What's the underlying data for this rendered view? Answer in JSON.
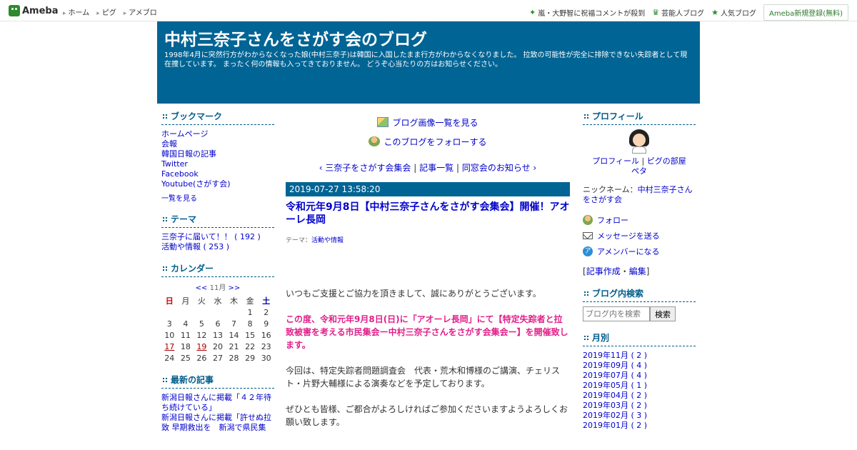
{
  "topbar": {
    "logo_text": "Ameba",
    "nav": [
      "ホーム",
      "ピグ",
      "アメブロ"
    ],
    "right_links": [
      {
        "label": "嵐・大野智に祝福コメントが殺到",
        "icon": "sparkle-icon"
      },
      {
        "label": "芸能人ブログ",
        "icon": "crown-icon"
      },
      {
        "label": "人気ブログ",
        "icon": "star-icon"
      }
    ],
    "signup_label": "Ameba新規登録(無料)"
  },
  "header": {
    "title": "中村三奈子さんをさがす会のブログ",
    "description": "1998年4月に突然行方がわからなくなった娘(中村三奈子)は韓国に入国したまま行方がわからなくなりました。 拉致の可能性が完全に排除できない失踪者として現在捜しています。 まったく何の情報も入ってきておりません。 どうぞ心当たりの方はお知らせください。"
  },
  "left": {
    "bookmarks": {
      "heading": "ブックマーク",
      "items": [
        "ホームページ",
        "会報",
        "韓国日報の記事",
        "Twitter",
        "Facebook",
        "Youtube(さがす会)"
      ],
      "more": "一覧を見る"
    },
    "themes": {
      "heading": "テーマ",
      "items": [
        "三奈子に届いて！！ ( 192 )",
        "活動や情報 ( 253 )"
      ]
    },
    "calendar": {
      "heading": "カレンダー",
      "prev": "<<",
      "month": "11月",
      "next": ">>",
      "weekdays": [
        "日",
        "月",
        "火",
        "水",
        "木",
        "金",
        "土"
      ],
      "weeks": [
        [
          "",
          "",
          "",
          "",
          "",
          "1",
          "2"
        ],
        [
          "3",
          "4",
          "5",
          "6",
          "7",
          "8",
          "9"
        ],
        [
          "10",
          "11",
          "12",
          "13",
          "14",
          "15",
          "16"
        ],
        [
          "17",
          "18",
          "19",
          "20",
          "21",
          "22",
          "23"
        ],
        [
          "24",
          "25",
          "26",
          "27",
          "28",
          "29",
          "30"
        ]
      ],
      "linked_days": [
        "17",
        "19"
      ]
    },
    "recent": {
      "heading": "最新の記事",
      "items": [
        "新潟日報さんに掲載「４２年待ち続けている」",
        "新潟日報さんに掲載「許せぬ拉致 早期救出を　新潟で県民集"
      ]
    }
  },
  "center": {
    "image_list_link": "ブログ画像一覧を見る",
    "follow_link": "このブログをフォローする",
    "pager": {
      "prev": "三奈子をさがす会集会",
      "sep1": "|",
      "list": "記事一覧",
      "sep2": "|",
      "next": "同窓会のお知らせ"
    },
    "entry": {
      "date": "2019-07-27 13:58:20",
      "title": "令和元年9月8日【中村三奈子さんをさがす会集会】開催！アオーレ長岡",
      "theme_label": "テーマ：",
      "theme": "活動や情報",
      "p1": "いつもご支援とご協力を頂きまして、誠にありがとうございます。",
      "p2": "この度、令和元年9月8日(日)に「アオーレ長岡」にて【特定失踪者と拉致被害を考える市民集会ー中村三奈子さんをさがす会集会ー】を開催致します。",
      "p3": "今回は、特定失踪者問題調査会　代表・荒木和博様のご講演、チェリスト・片野大輔様による演奏などを予定しております。",
      "p4": "ぜひとも皆様、ご都合がよろしければご参加くださいますようよろしくお願い致します。"
    }
  },
  "right": {
    "profile": {
      "heading": "プロフィール",
      "link_profile": "プロフィール",
      "sep": "|",
      "link_pigu": "ピグの部屋",
      "link_peta": "ペタ",
      "nickname_label": "ニックネーム：",
      "nickname": "中村三奈子さんをさがす会"
    },
    "actions": {
      "follow": "フォロー",
      "message": "メッセージを送る",
      "amember": "アメンバーになる",
      "amember_glyph": "ア"
    },
    "edit": {
      "open": "[",
      "create": "記事作成",
      "dot": "・",
      "edit": "編集",
      "close": "]"
    },
    "search": {
      "heading": "ブログ内検索",
      "placeholder": "ブログ内を検索",
      "button": "検索"
    },
    "monthly": {
      "heading": "月別",
      "items": [
        "2019年11月 ( 2 )",
        "2019年09月 ( 4 )",
        "2019年07月 ( 4 )",
        "2019年05月 ( 1 )",
        "2019年04月 ( 2 )",
        "2019年03月 ( 2 )",
        "2019年02月 ( 3 )",
        "2019年01月 ( 2 )"
      ]
    }
  },
  "colors": {
    "header_bg": "#006494",
    "link": "#0000cc",
    "accent_green": "#2d8a2d",
    "pink": "#e0208a"
  }
}
